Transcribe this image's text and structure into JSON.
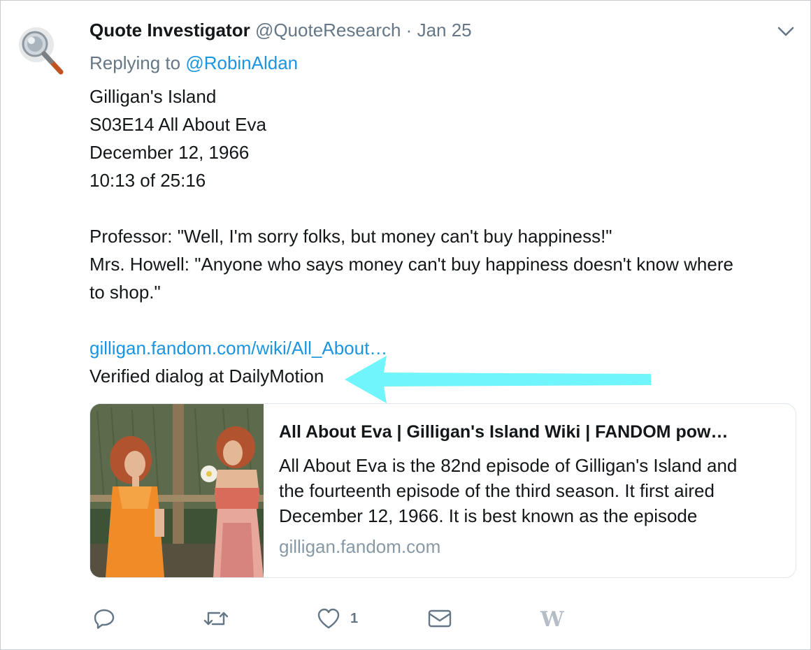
{
  "tweet": {
    "author_name": "Quote Investigator",
    "handle": "@QuoteResearch",
    "separator": "·",
    "date": "Jan 25",
    "replying_prefix": "Replying to",
    "replying_to": "@RobinAldan",
    "text_lines": [
      "Gilligan's Island",
      "S03E14 All About Eva",
      "December 12, 1966",
      "10:13 of 25:16",
      "Professor: \"Well, I'm sorry folks, but money can't buy happiness!\"",
      "Mrs. Howell: \"Anyone who says money can't buy happiness doesn't know where",
      "to shop.\""
    ],
    "link_text": "gilligan.fandom.com/wiki/All_About…",
    "verified_line": "Verified dialog at DailyMotion"
  },
  "card": {
    "title": "All About Eva | Gilligan's Island Wiki | FANDOM pow…",
    "description_lines": [
      "All About Eva is the 82nd episode of Gilligan's Island and",
      "the fourteenth episode of the third season. It first aired",
      "December 12, 1966. It is best known as the episode"
    ],
    "domain": "gilligan.fandom.com"
  },
  "actions": {
    "reply_icon": "reply-icon",
    "retweet_icon": "retweet-icon",
    "like_icon": "heart-icon",
    "like_count": "1",
    "message_icon": "envelope-icon",
    "extension_icon": "w-logo-icon",
    "extension_text": "W"
  },
  "colors": {
    "link": "#1b95e0",
    "secondary_text": "#657786",
    "annotation_arrow": "#6ff5fb"
  }
}
